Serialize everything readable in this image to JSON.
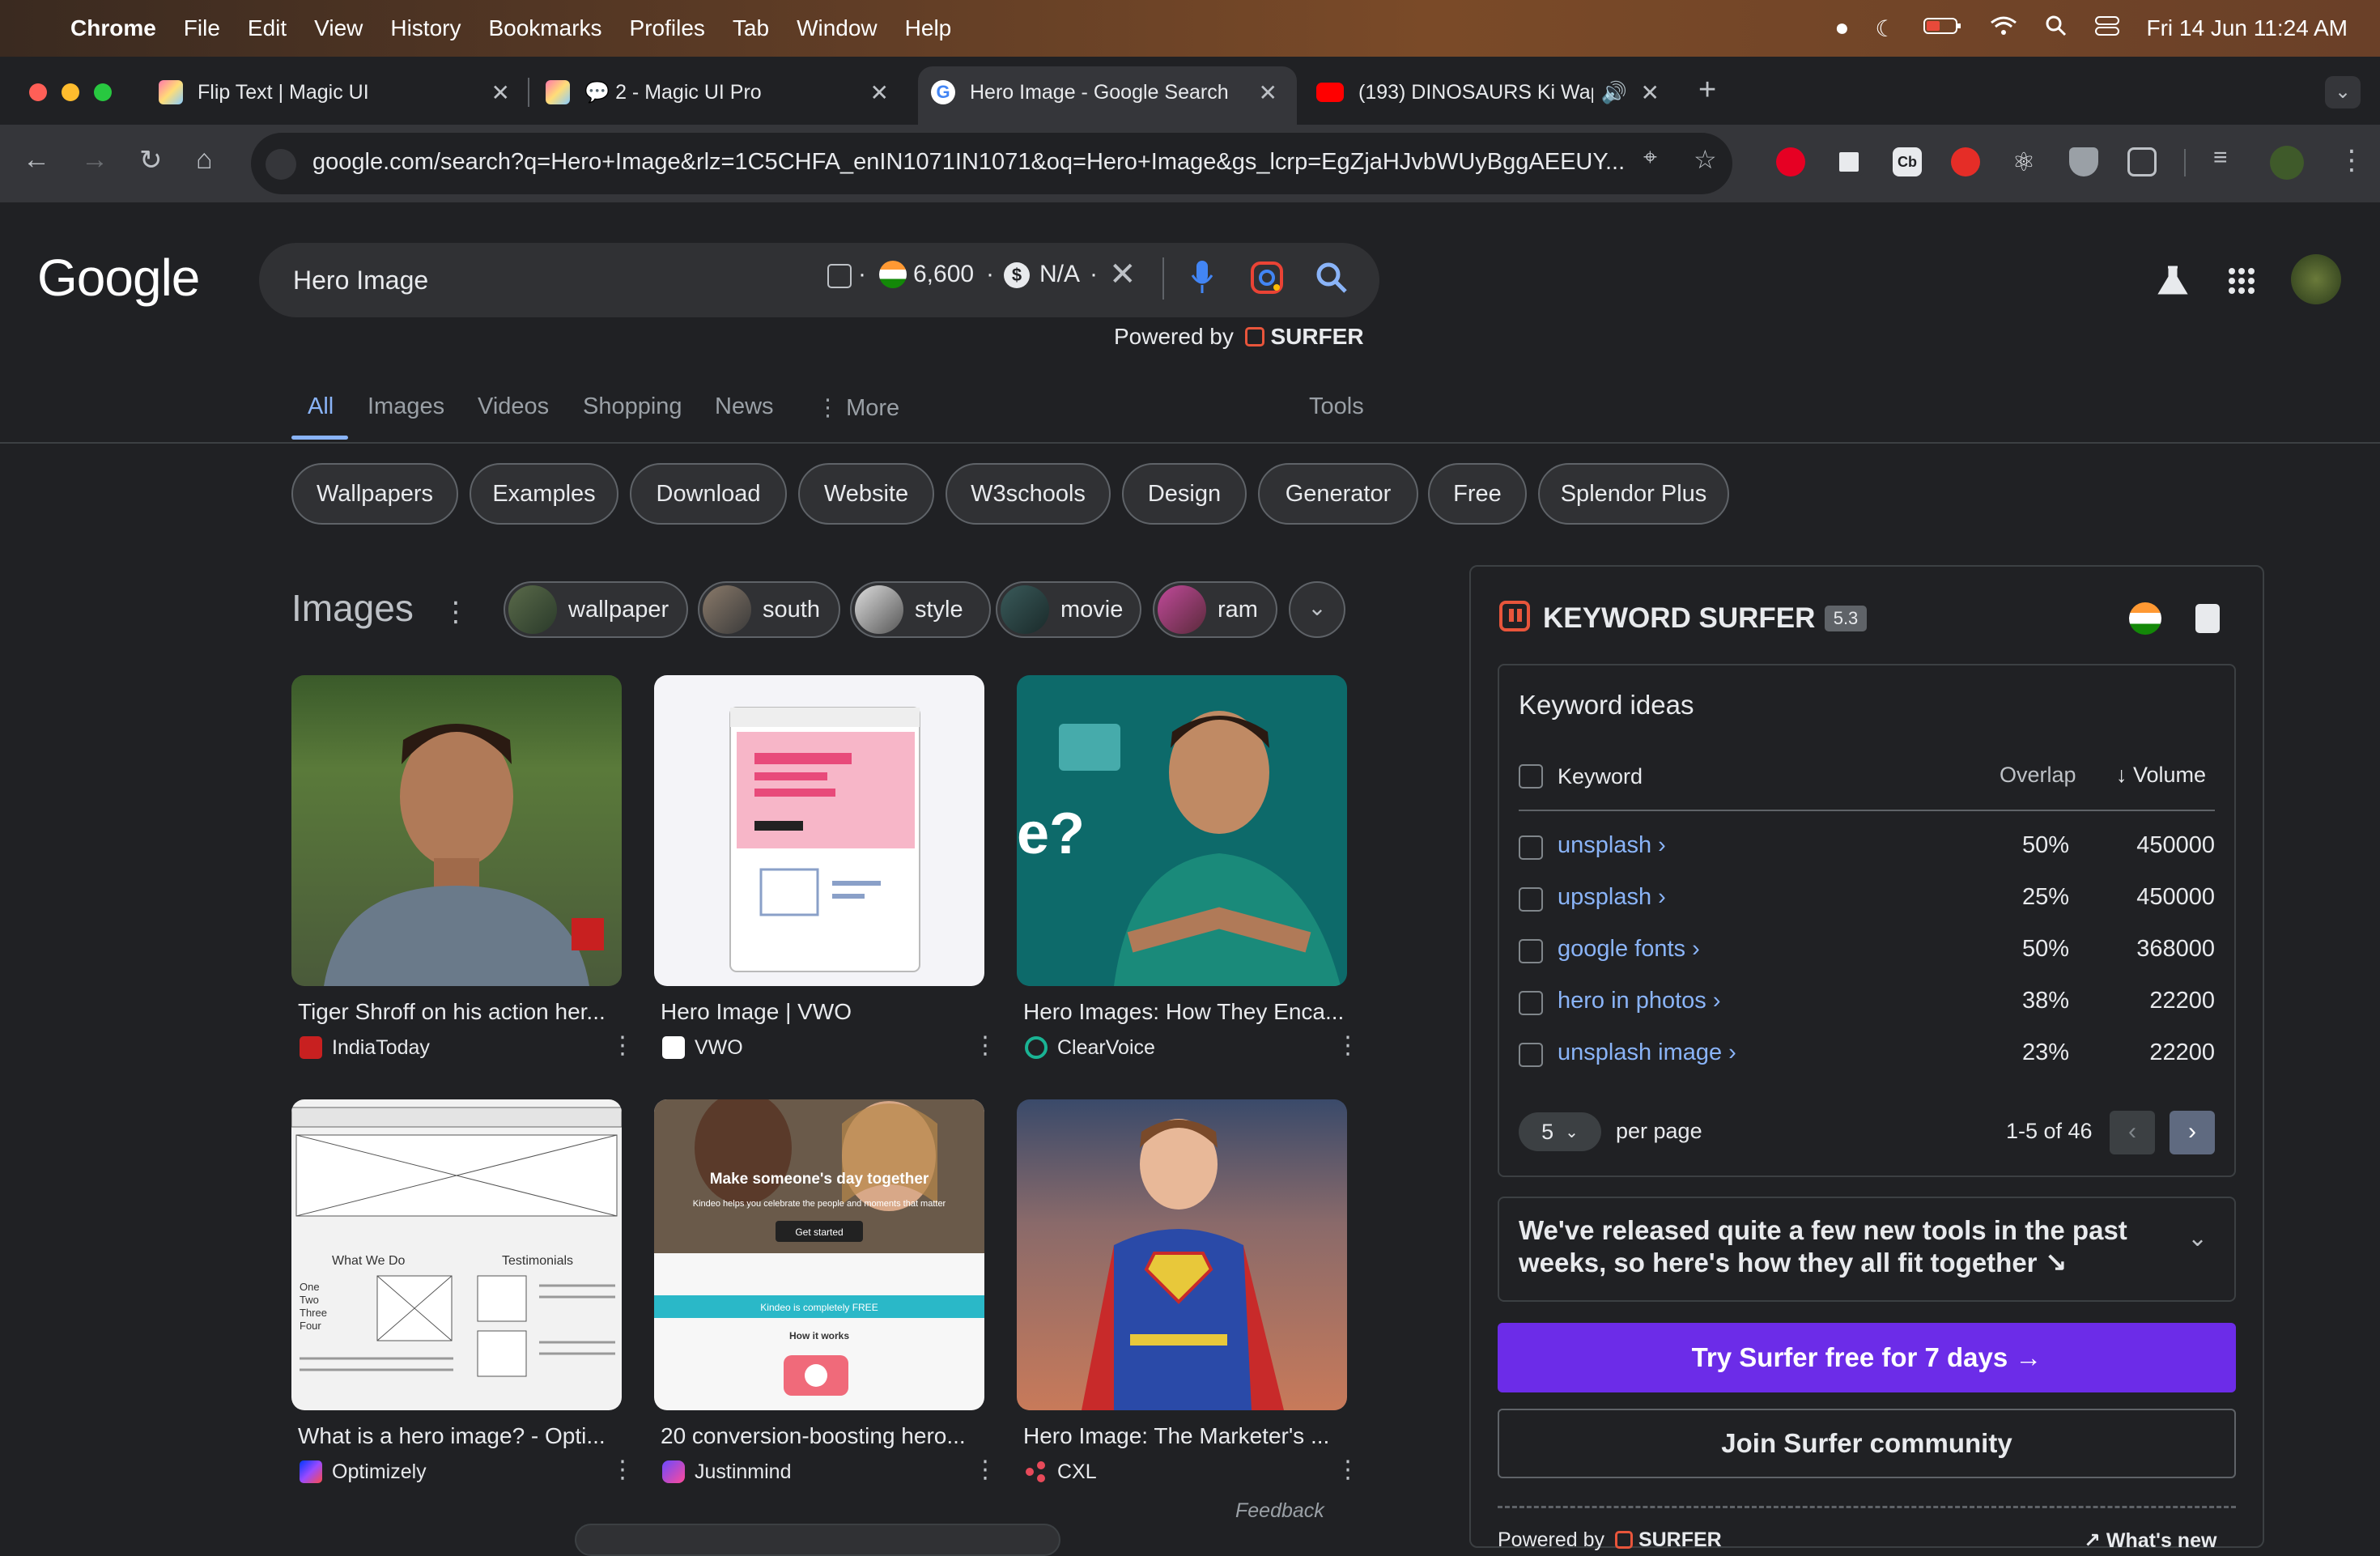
{
  "menubar": {
    "app": "Chrome",
    "items": [
      "File",
      "Edit",
      "View",
      "History",
      "Bookmarks",
      "Profiles",
      "Tab",
      "Window",
      "Help"
    ],
    "datetime": "Fri 14 Jun  11:24 AM"
  },
  "tabs": [
    {
      "title": "Flip Text | Magic UI"
    },
    {
      "title": "💬 2 - Magic UI Pro"
    },
    {
      "title": "Hero Image - Google Search"
    },
    {
      "title": "(193) DINOSAURS Ki Wap"
    }
  ],
  "toolbar": {
    "url": "google.com/search?q=Hero+Image&rlz=1C5CHFA_enIN1071IN1071&oq=Hero+Image&gs_lcrp=EgZjaHJvbWUyBggAEEUY..."
  },
  "google": {
    "logo": "Google",
    "query": "Hero Image",
    "metric_volume": "6,600",
    "metric_cpc": "N/A",
    "powered_by": "Powered by",
    "surfer_brand": "SURFER",
    "nav": {
      "all": "All",
      "images": "Images",
      "videos": "Videos",
      "shopping": "Shopping",
      "news": "News",
      "more": "More",
      "tools": "Tools"
    },
    "chips": [
      "Wallpapers",
      "Examples",
      "Download",
      "Website",
      "W3schools",
      "Design",
      "Generator",
      "Free",
      "Splendor Plus"
    ],
    "images_title": "Images",
    "image_chips": [
      "wallpaper",
      "south",
      "style",
      "movie",
      "ram"
    ],
    "results": [
      {
        "caption": "Tiger Shroff on his action her...",
        "source": "IndiaToday"
      },
      {
        "caption": "Hero Image | VWO",
        "source": "VWO"
      },
      {
        "caption": "Hero Images: How They Enca...",
        "source": "ClearVoice"
      },
      {
        "caption": "What is a hero image? - Opti...",
        "source": "Optimizely"
      },
      {
        "caption": "20 conversion-boosting hero...",
        "source": "Justinmind"
      },
      {
        "caption": "Hero Image: The Marketer's ...",
        "source": "CXL"
      }
    ],
    "feedback": "Feedback",
    "thumb_text": {
      "q_mark": "e?",
      "slide_title": "Make someone's day together",
      "slide_sub": "Kindeo helps you celebrate the people and moments that matter",
      "get_started": "Get started",
      "free_banner": "Kindeo is completely FREE",
      "how_it_works": "How it works",
      "what_we_do": "What We Do",
      "testimonials": "Testimonials",
      "list": [
        "One",
        "Two",
        "Three",
        "Four"
      ]
    }
  },
  "surfer": {
    "title": "KEYWORD SURFER",
    "version": "5.3",
    "section_title": "Keyword ideas",
    "col_keyword": "Keyword",
    "col_overlap": "Overlap",
    "col_volume": "↓ Volume",
    "rows": [
      {
        "keyword": "unsplash ›",
        "overlap": "50%",
        "volume": "450000"
      },
      {
        "keyword": "upsplash ›",
        "overlap": "25%",
        "volume": "450000"
      },
      {
        "keyword": "google fonts ›",
        "overlap": "50%",
        "volume": "368000"
      },
      {
        "keyword": "hero in photos ›",
        "overlap": "38%",
        "volume": "22200"
      },
      {
        "keyword": "unsplash image ›",
        "overlap": "23%",
        "volume": "22200"
      }
    ],
    "per_page_value": "5",
    "per_page_label": "per page",
    "range": "1-5 of 46",
    "notice": "We've released quite a few new tools in the past weeks, so here's how they all fit together ↘",
    "try_button": "Try Surfer free for 7 days →",
    "join_button": "Join Surfer community",
    "footer_powered": "Powered by",
    "footer_brand": "SURFER",
    "whats_new": "What's new"
  }
}
